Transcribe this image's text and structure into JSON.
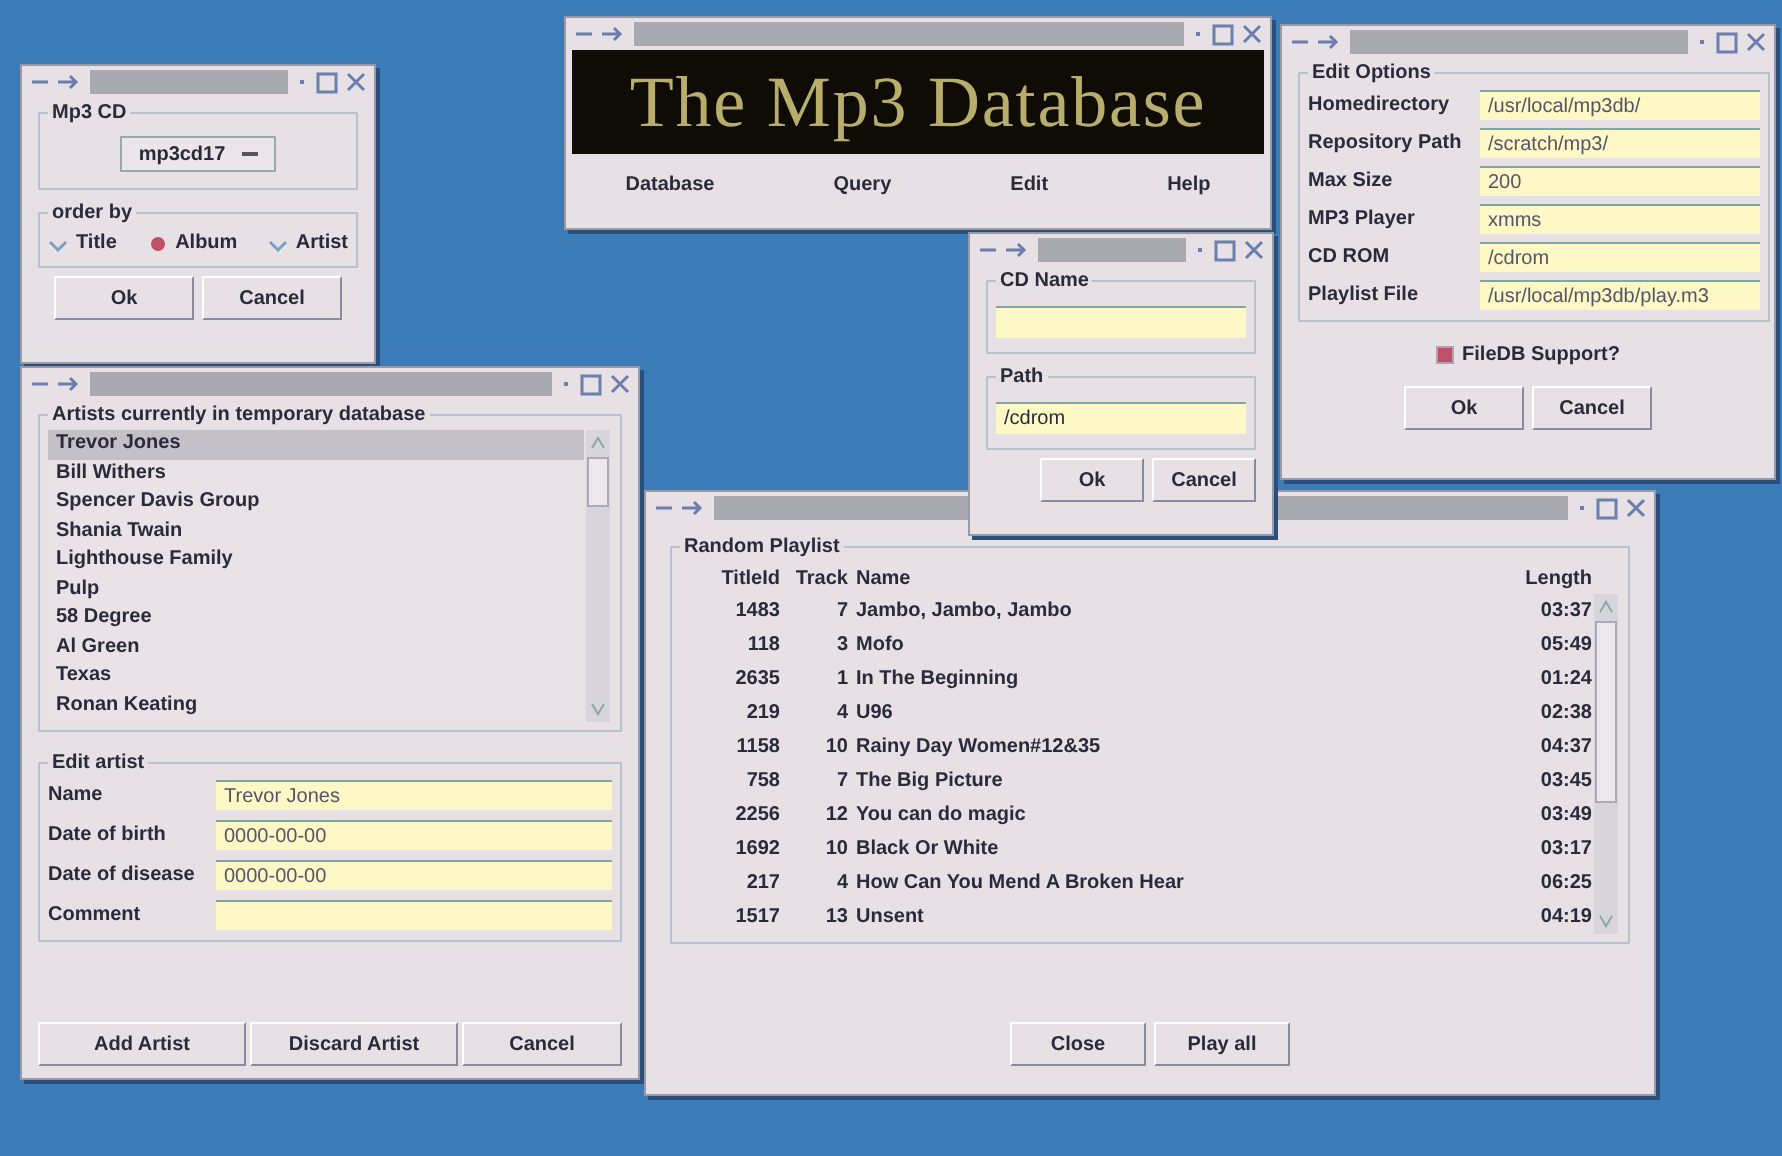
{
  "order_dialog": {
    "cd_group": "Mp3 CD",
    "cd_select": "mp3cd17",
    "order_group": "order by",
    "options": [
      {
        "label": "Title",
        "selected": false
      },
      {
        "label": "Album",
        "selected": true
      },
      {
        "label": "Artist",
        "selected": false
      }
    ],
    "buttons": [
      "Ok",
      "Cancel"
    ]
  },
  "main_window": {
    "banner": "The Mp3 Database",
    "menu": [
      "Database",
      "Query",
      "Edit",
      "Help"
    ]
  },
  "options_dialog": {
    "group": "Edit Options",
    "fields": [
      {
        "label": "Homedirectory",
        "value": "/usr/local/mp3db/"
      },
      {
        "label": "Repository Path",
        "value": "/scratch/mp3/"
      },
      {
        "label": "Max Size",
        "value": "200"
      },
      {
        "label": "MP3 Player",
        "value": "xmms"
      },
      {
        "label": "CD ROM",
        "value": "/cdrom"
      },
      {
        "label": "Playlist File",
        "value": "/usr/local/mp3db/play.m3"
      }
    ],
    "support": {
      "label": "FileDB Support?",
      "checked": true
    },
    "buttons": [
      "Ok",
      "Cancel"
    ]
  },
  "artists_window": {
    "group": "Artists currently in temporary database",
    "artists": [
      {
        "name": "Trevor Jones",
        "selected": true
      },
      {
        "name": "Bill Withers",
        "selected": false
      },
      {
        "name": "Spencer Davis Group",
        "selected": false
      },
      {
        "name": "Shania Twain",
        "selected": false
      },
      {
        "name": "Lighthouse Family",
        "selected": false
      },
      {
        "name": "Pulp",
        "selected": false
      },
      {
        "name": "58 Degree",
        "selected": false
      },
      {
        "name": "Al Green",
        "selected": false
      },
      {
        "name": "Texas",
        "selected": false
      },
      {
        "name": "Ronan Keating",
        "selected": false
      }
    ],
    "edit_group": "Edit artist",
    "fields": [
      {
        "label": "Name",
        "value": "Trevor Jones"
      },
      {
        "label": "Date of birth",
        "value": "0000-00-00"
      },
      {
        "label": "Date of disease",
        "value": "0000-00-00"
      },
      {
        "label": "Comment"
      }
    ],
    "buttons": [
      "Add Artist",
      "Discard Artist",
      "Cancel"
    ]
  },
  "playlist_window": {
    "group": "Random Playlist",
    "columns": [
      "TitleId",
      "Track",
      "Name",
      "Length"
    ],
    "rows": [
      [
        "1483",
        "7",
        "Jambo, Jambo, Jambo",
        "03:37"
      ],
      [
        "118",
        "3",
        "Mofo",
        "05:49"
      ],
      [
        "2635",
        "1",
        "In The Beginning",
        "01:24"
      ],
      [
        "219",
        "4",
        "U96",
        "02:38"
      ],
      [
        "1158",
        "10",
        "Rainy Day Women#12&35",
        "04:37"
      ],
      [
        "758",
        "7",
        "The Big Picture",
        "03:45"
      ],
      [
        "2256",
        "12",
        "You can do magic",
        "03:49"
      ],
      [
        "1692",
        "10",
        "Black Or White",
        "03:17"
      ],
      [
        "217",
        "4",
        "How Can You Mend A Broken Hear",
        "06:25"
      ],
      [
        "1517",
        "13",
        "Unsent",
        "04:19"
      ]
    ],
    "buttons": [
      "Close",
      "Play all"
    ]
  },
  "cd_dialog": {
    "name_group": "CD Name",
    "path_group": "Path",
    "path_value": "/cdrom",
    "buttons": [
      "Ok",
      "Cancel"
    ]
  }
}
